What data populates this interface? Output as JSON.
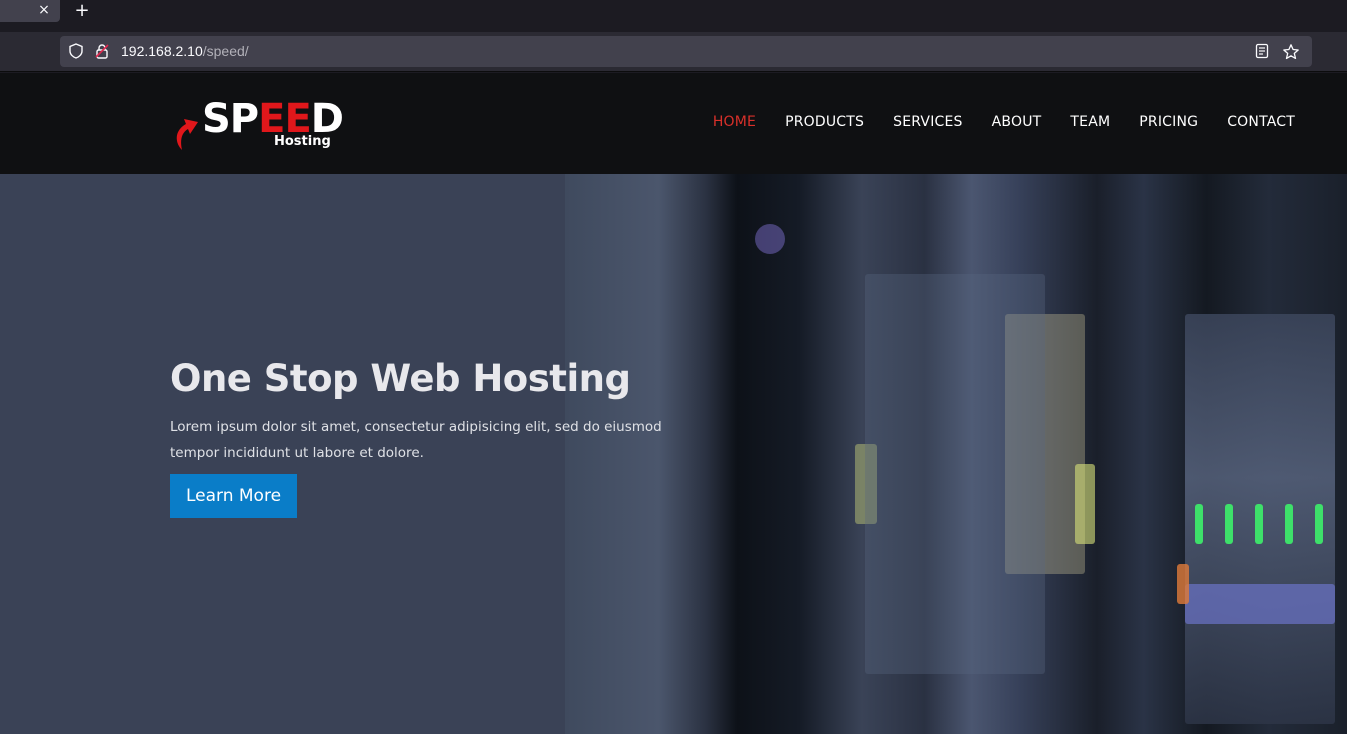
{
  "browser": {
    "tab_close_glyph": "×",
    "new_tab_glyph": "+",
    "url_host": "192.168.2.10",
    "url_path": "/speed/"
  },
  "site": {
    "logo": {
      "word_pre": "SP",
      "word_mid": "EE",
      "word_post": "D",
      "sub": "Hosting"
    },
    "menu": [
      {
        "label": "HOME",
        "active": true
      },
      {
        "label": "PRODUCTS",
        "active": false
      },
      {
        "label": "SERVICES",
        "active": false
      },
      {
        "label": "ABOUT",
        "active": false
      },
      {
        "label": "TEAM",
        "active": false
      },
      {
        "label": "PRICING",
        "active": false
      },
      {
        "label": "CONTACT",
        "active": false
      }
    ],
    "hero": {
      "title": "One Stop Web Hosting",
      "text": "Lorem ipsum dolor sit amet, consectetur adipisicing elit, sed do eiusmod tempor incididunt ut labore et dolore.",
      "button": "Learn More"
    }
  },
  "colors": {
    "accent_red": "#e0171b",
    "active_menu": "#d9302a",
    "button_blue": "#0a7dc8",
    "header_bg": "#0f1012",
    "hero_bg": "#3a4256"
  }
}
